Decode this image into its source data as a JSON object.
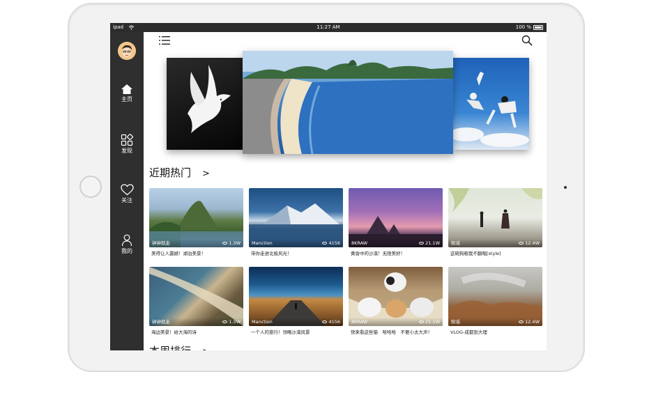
{
  "status_bar": {
    "carrier": "ipad",
    "time": "11:27 AM",
    "battery": "100 %"
  },
  "sidebar": {
    "items": [
      {
        "label": "主页",
        "icon": "home-icon"
      },
      {
        "label": "发现",
        "icon": "discover-icon"
      },
      {
        "label": "关注",
        "icon": "heart-icon"
      },
      {
        "label": "我的",
        "icon": "user-icon"
      }
    ]
  },
  "sections": {
    "hot": {
      "title": "近期热门",
      "arrow": ">"
    },
    "weekly": {
      "title": "本周排行",
      "arrow": ">"
    }
  },
  "tiles": [
    {
      "author": "钟钟就走",
      "views": "1.3W",
      "caption": "美得让人震撼！湖泊美景！"
    },
    {
      "author": "Manction",
      "views": "4156",
      "caption": "带你走进北极风光！"
    },
    {
      "author": "8KRAW",
      "views": "21.1W",
      "caption": "黄昏中的沙漠！无限美好！"
    },
    {
      "author": "知谣",
      "views": "12.4W",
      "caption": "这碗狗粮我不翻唱[style]"
    },
    {
      "author": "钟钟就走",
      "views": "1.3W",
      "caption": "海边美景！给大海的诗"
    },
    {
      "author": "Manction",
      "views": "4156",
      "caption": "一个人的旅行！领略沙漠风景"
    },
    {
      "author": "8KRAW",
      "views": "21.1W",
      "caption": "快来看这些猫　哈哈哈　不要小太大声！"
    },
    {
      "author": "知谣",
      "views": "12.4W",
      "caption": "VLOG-成都到大理"
    }
  ],
  "colors": {
    "sidebar": "#2f2f2f",
    "statusbar": "#2c2c2c"
  }
}
